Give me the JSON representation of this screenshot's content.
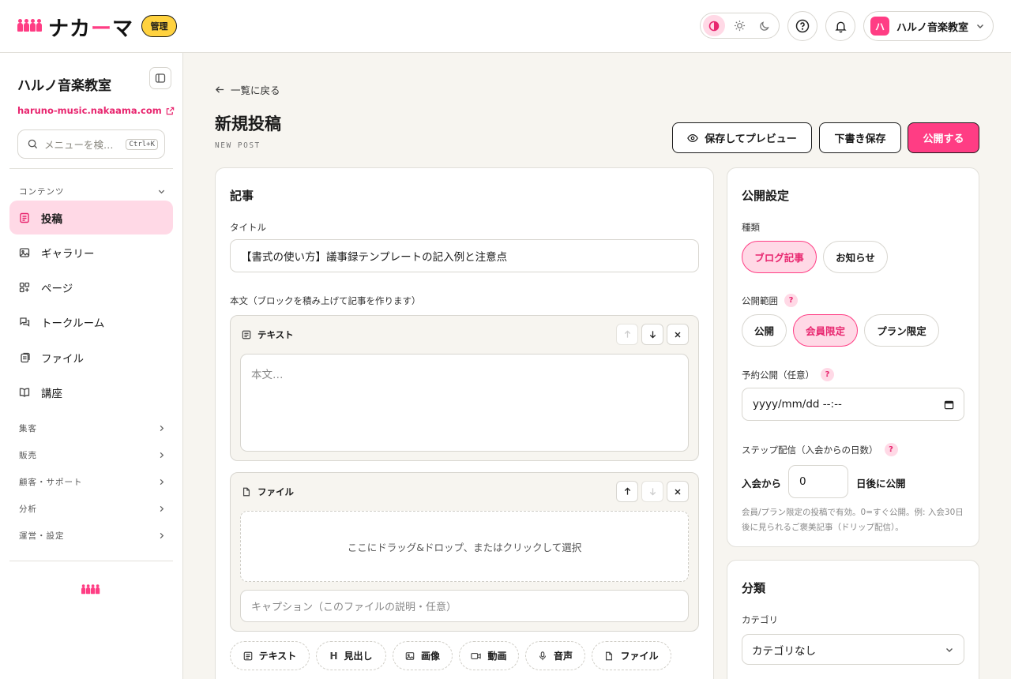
{
  "header": {
    "brand_name_a": "ナカ",
    "brand_name_dash": "ー",
    "brand_name_b": "マ",
    "admin_badge": "管理",
    "account_initial": "ハ",
    "account_name": "ハルノ音楽教室"
  },
  "sidebar": {
    "site_title": "ハルノ音楽教室",
    "site_url": "haruno-music.nakaama.com",
    "search_placeholder": "メニューを検…",
    "search_shortcut": "Ctrl+K",
    "section_contents": "コンテンツ",
    "items": [
      {
        "label": "投稿",
        "icon": "document-icon",
        "active": true
      },
      {
        "label": "ギャラリー",
        "icon": "image-icon"
      },
      {
        "label": "ページ",
        "icon": "pages-icon"
      },
      {
        "label": "トークルーム",
        "icon": "chat-icon"
      },
      {
        "label": "ファイル",
        "icon": "files-icon"
      },
      {
        "label": "講座",
        "icon": "book-icon"
      }
    ],
    "sections": [
      "集客",
      "販売",
      "顧客・サポート",
      "分析",
      "運営・設定"
    ]
  },
  "main": {
    "back_label": "一覧に戻る",
    "title": "新規投稿",
    "subtitle": "NEW POST",
    "preview_button": "保存してプレビュー",
    "draft_button": "下書き保存",
    "publish_button": "公開する"
  },
  "article": {
    "heading": "記事",
    "title_label": "タイトル",
    "title_value": "【書式の使い方】議事録テンプレートの記入例と注意点",
    "body_label": "本文（ブロックを積み上げて記事を作ります）",
    "text_block_label": "テキスト",
    "text_placeholder": "本文…",
    "file_block_label": "ファイル",
    "dropzone_text": "ここにドラッグ&ドロップ、またはクリックして選択",
    "caption_placeholder": "キャプション（このファイルの説明・任意）",
    "add_blocks": [
      {
        "label": "テキスト",
        "icon": "text-icon"
      },
      {
        "label": "見出し",
        "icon": "heading-icon"
      },
      {
        "label": "画像",
        "icon": "image-icon"
      },
      {
        "label": "動画",
        "icon": "video-icon"
      },
      {
        "label": "音声",
        "icon": "mic-icon"
      },
      {
        "label": "ファイル",
        "icon": "file-icon"
      }
    ]
  },
  "publish": {
    "heading": "公開設定",
    "type_label": "種類",
    "type_options": [
      "ブログ記事",
      "お知らせ"
    ],
    "type_selected": "ブログ記事",
    "scope_label": "公開範囲",
    "scope_options": [
      "公開",
      "会員限定",
      "プラン限定"
    ],
    "scope_selected": "会員限定",
    "schedule_label": "予約公開（任意）",
    "schedule_placeholder": "yyyy/mm/dd --:--",
    "step_label": "ステップ配信（入会からの日数）",
    "step_prefix": "入会から",
    "step_value": "0",
    "step_suffix": "日後に公開",
    "step_note": "会員/プラン限定の投稿で有効。0=すぐ公開。例: 入会30日後に見られるご褒美記事（ドリップ配信）。"
  },
  "category": {
    "heading": "分類",
    "label": "カテゴリ",
    "selected": "カテゴリなし"
  },
  "colors": {
    "accent": "#ff3d84",
    "badge": "#ffd23f",
    "active_bg": "#ffd9e6"
  }
}
